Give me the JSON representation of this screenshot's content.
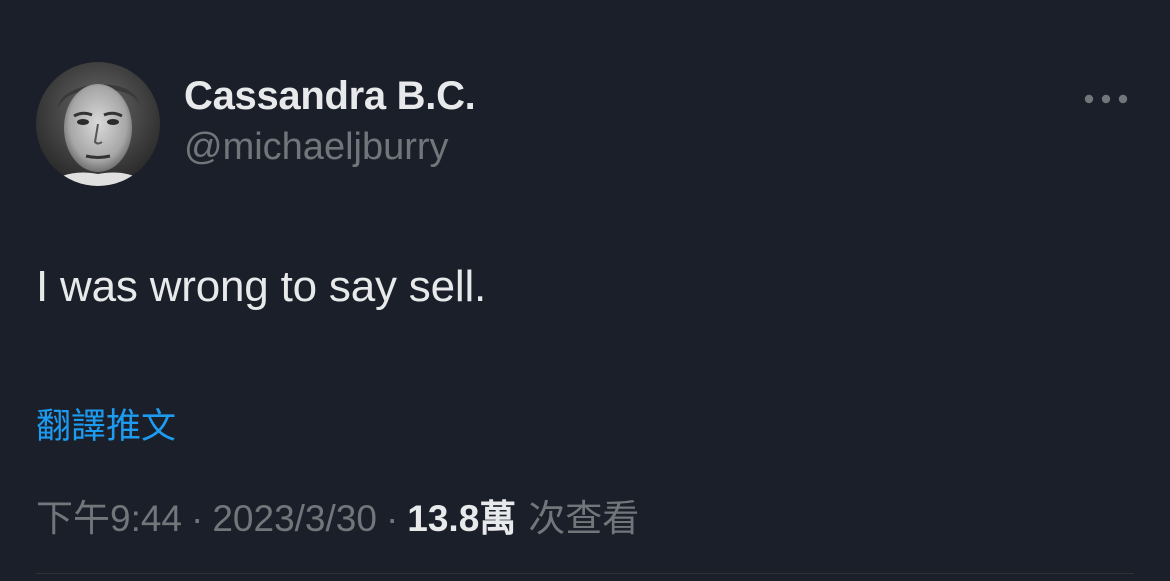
{
  "colors": {
    "background": "#1b1f29",
    "primary_text": "#e7e9ea",
    "secondary_text": "#71767b",
    "link": "#1d9bf0",
    "divider": "#2f3336"
  },
  "author": {
    "display_name": "Cassandra B.C.",
    "handle": "@michaeljburry",
    "avatar_icon": "grayscale-portrait-avatar"
  },
  "more_menu": {
    "icon": "more-horizontal-icon"
  },
  "tweet": {
    "text": "I was wrong to say sell.",
    "translate_label": "翻譯推文"
  },
  "meta": {
    "time": "下午9:44",
    "separator": "·",
    "date": "2023/3/30",
    "views_count": "13.8萬",
    "views_label": "次查看"
  }
}
